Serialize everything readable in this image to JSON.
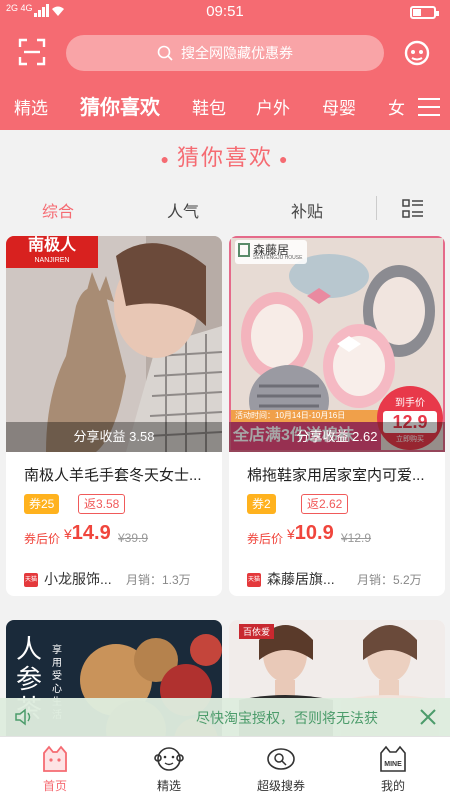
{
  "status_bar": {
    "signal": "2G 4G",
    "time": "09:51"
  },
  "header": {
    "search_placeholder": "搜全网隐藏优惠券",
    "categories": [
      "精选",
      "猜你喜欢",
      "鞋包",
      "户外",
      "母婴",
      "女"
    ],
    "active_category": "猜你喜欢"
  },
  "section": {
    "title": "猜你喜欢"
  },
  "sort_tabs": [
    "综合",
    "人气",
    "补贴"
  ],
  "products": [
    {
      "brand_logo": "南极人",
      "brand_logo_sub": "NANJIREN",
      "share_income": "分享收益 3.58",
      "title": "南极人羊毛手套冬天女士...",
      "coupon": "券25",
      "rebate": "返3.58",
      "price_label": "券后价",
      "currency": "¥",
      "price": "14.9",
      "original_price": "¥39.9",
      "shop": "小龙服饰...",
      "sales": "月销：1.3万"
    },
    {
      "brand_logo": "森藤居",
      "brand_logo_sub": "SENTENGJU HOUSE",
      "promo_date": "活动时间：10月14日-10月16日",
      "promo_banner": "全店满3件送棉袜",
      "badge_top": "到手价",
      "badge_price": "12.9",
      "badge_bottom": "立即购买",
      "share_income": "分享收益 2.62",
      "title": "棉拖鞋家用居家室内可爱...",
      "coupon": "券2",
      "rebate": "返2.62",
      "price_label": "券后价",
      "currency": "¥",
      "price": "10.9",
      "original_price": "¥12.9",
      "shop": "森藤居旗...",
      "sales": "月销：5.2万"
    },
    {
      "brand_text": "人参茶",
      "side_text": "享用受心生活"
    },
    {
      "brand_text": "百依爱"
    }
  ],
  "notice": {
    "text": "尽快淘宝授权，否则将无法获"
  },
  "tabbar": [
    {
      "label": "首页",
      "icon": "home-cat-icon"
    },
    {
      "label": "精选",
      "icon": "monkey-face-icon"
    },
    {
      "label": "超级搜券",
      "icon": "coupon-search-icon"
    },
    {
      "label": "我的",
      "icon": "mine-cat-icon",
      "icon_text": "MINE"
    }
  ],
  "colors": {
    "brand": "#f56b72",
    "price": "#f0453c",
    "coupon": "#ffb21e",
    "notice_text": "#4c9c6b"
  }
}
